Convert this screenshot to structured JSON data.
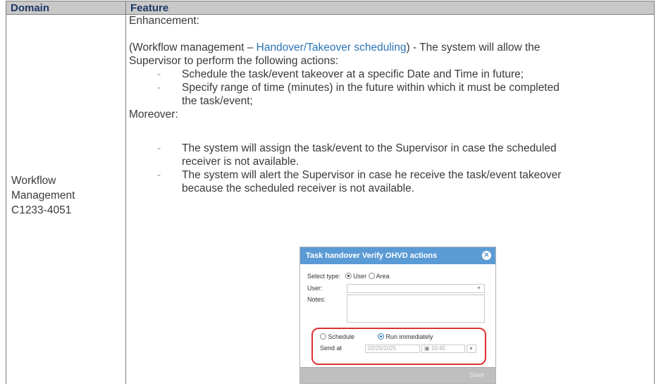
{
  "table": {
    "headers": {
      "domain": "Domain",
      "feature": "Feature"
    },
    "domain_cell": {
      "lines": [
        "Workflow",
        "Management",
        "C1233-4051"
      ]
    },
    "feature_cell": {
      "heading": "Enhancement:",
      "intro_prefix": "(Workflow management – ",
      "intro_link": "Handover/Takeover scheduling",
      "intro_suffix": ") - The system will allow the",
      "intro_line2": "Supervisor to perform the following actions:",
      "bullets_1": [
        {
          "line1": "Schedule the task/event takeover at a specific Date and Time in future;",
          "line2": ""
        },
        {
          "line1": "Specify range of time (minutes) in the future within which it must be completed",
          "line2": "the task/event;"
        }
      ],
      "moreover": "Moreover:",
      "bullets_2": [
        {
          "line1": "The system will assign the task/event to the Supervisor in case the scheduled",
          "line2": "receiver is not available."
        },
        {
          "line1": "The system will alert the Supervisor in case he receive the task/event takeover",
          "line2": "because the scheduled receiver is not available."
        }
      ],
      "dash": "-"
    }
  },
  "dialog": {
    "title": "Task handover Verify OHVD actions",
    "close_icon": "close-icon",
    "select_type_label": "Select type:",
    "type_options": [
      "User",
      "Area"
    ],
    "type_selected": "User",
    "user_label": "User:",
    "user_value": "",
    "notes_label": "Notes:",
    "schedule_label": "Schedule",
    "run_immediately_label": "Run immediately",
    "run_selected": "Run immediately",
    "send_at_label": "Send at",
    "date_value": "02/25/2025",
    "time_value": "10:40",
    "save_label": "Save",
    "highlight_color": "#e03030",
    "title_bar_color": "#5b9bd5"
  }
}
